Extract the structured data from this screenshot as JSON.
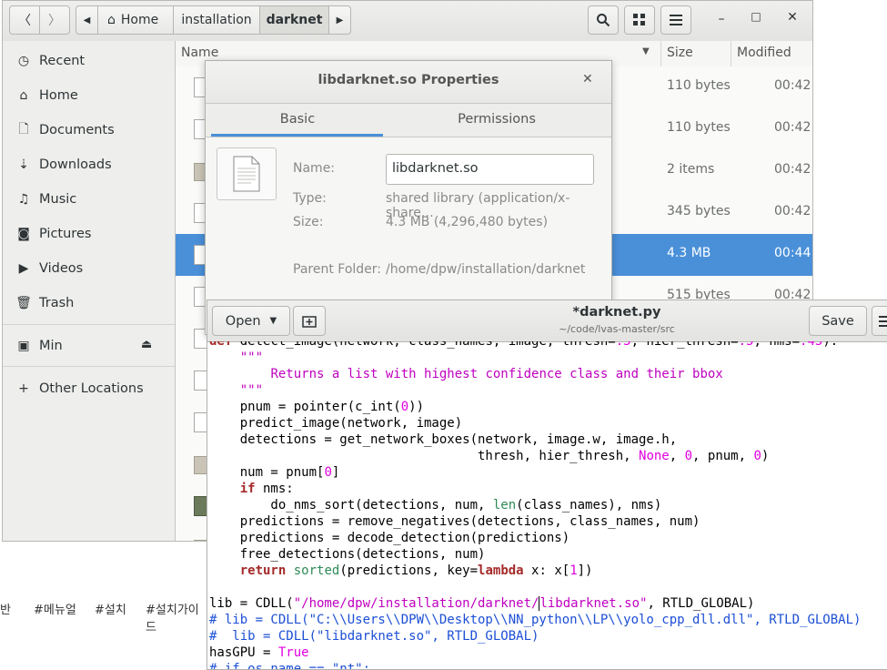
{
  "files": {
    "path": [
      "Home",
      "installation",
      "darknet"
    ],
    "sidebar": [
      {
        "label": "Recent",
        "icon": "clock-icon",
        "glyph": "◷"
      },
      {
        "label": "Home",
        "icon": "home-icon",
        "glyph": "⌂"
      },
      {
        "label": "Documents",
        "icon": "document-icon",
        "glyph": "🗋"
      },
      {
        "label": "Downloads",
        "icon": "download-icon",
        "glyph": "⇣"
      },
      {
        "label": "Music",
        "icon": "music-icon",
        "glyph": "♫"
      },
      {
        "label": "Pictures",
        "icon": "camera-icon",
        "glyph": "◙"
      },
      {
        "label": "Videos",
        "icon": "video-icon",
        "glyph": "▶"
      },
      {
        "label": "Trash",
        "icon": "trash-icon",
        "glyph": "🗑"
      },
      {
        "label": "Min",
        "icon": "drive-icon",
        "glyph": "▣"
      },
      {
        "label": "Other Locations",
        "icon": "plus-icon",
        "glyph": "+"
      }
    ],
    "columns": {
      "name": "Name",
      "size": "Size",
      "modified": "Modified"
    },
    "rows": [
      {
        "size": "110 bytes",
        "modified": "00:42"
      },
      {
        "size": "110 bytes",
        "modified": "00:42"
      },
      {
        "size": "2 items",
        "modified": "00:42"
      },
      {
        "size": "345 bytes",
        "modified": "00:42"
      },
      {
        "size": "4.3 MB",
        "modified": "00:44"
      },
      {
        "size": "515 bytes",
        "modified": "00:42"
      }
    ]
  },
  "properties": {
    "title": "libdarknet.so Properties",
    "tabs": [
      "Basic",
      "Permissions"
    ],
    "name_label": "Name:",
    "name_value": "libdarknet.so",
    "type_label": "Type:",
    "type_value": "shared library (application/x-share…",
    "size_label": "Size:",
    "size_value": "4.3 MB (4,296,480 bytes)",
    "parent_label": "Parent Folder:",
    "parent_value": "/home/dpw/installation/darknet"
  },
  "gedit": {
    "open_label": "Open",
    "title": "*darknet.py",
    "subtitle": "~/code/lvas-master/src",
    "save_label": "Save"
  },
  "tags": [
    "반",
    "#메뉴얼",
    "#설치",
    "#설치가이드"
  ],
  "colors": {
    "accent": "#4a90d9",
    "keyword": "#a52a2a",
    "string": "#c000c0",
    "comment": "#1c4fd6"
  }
}
